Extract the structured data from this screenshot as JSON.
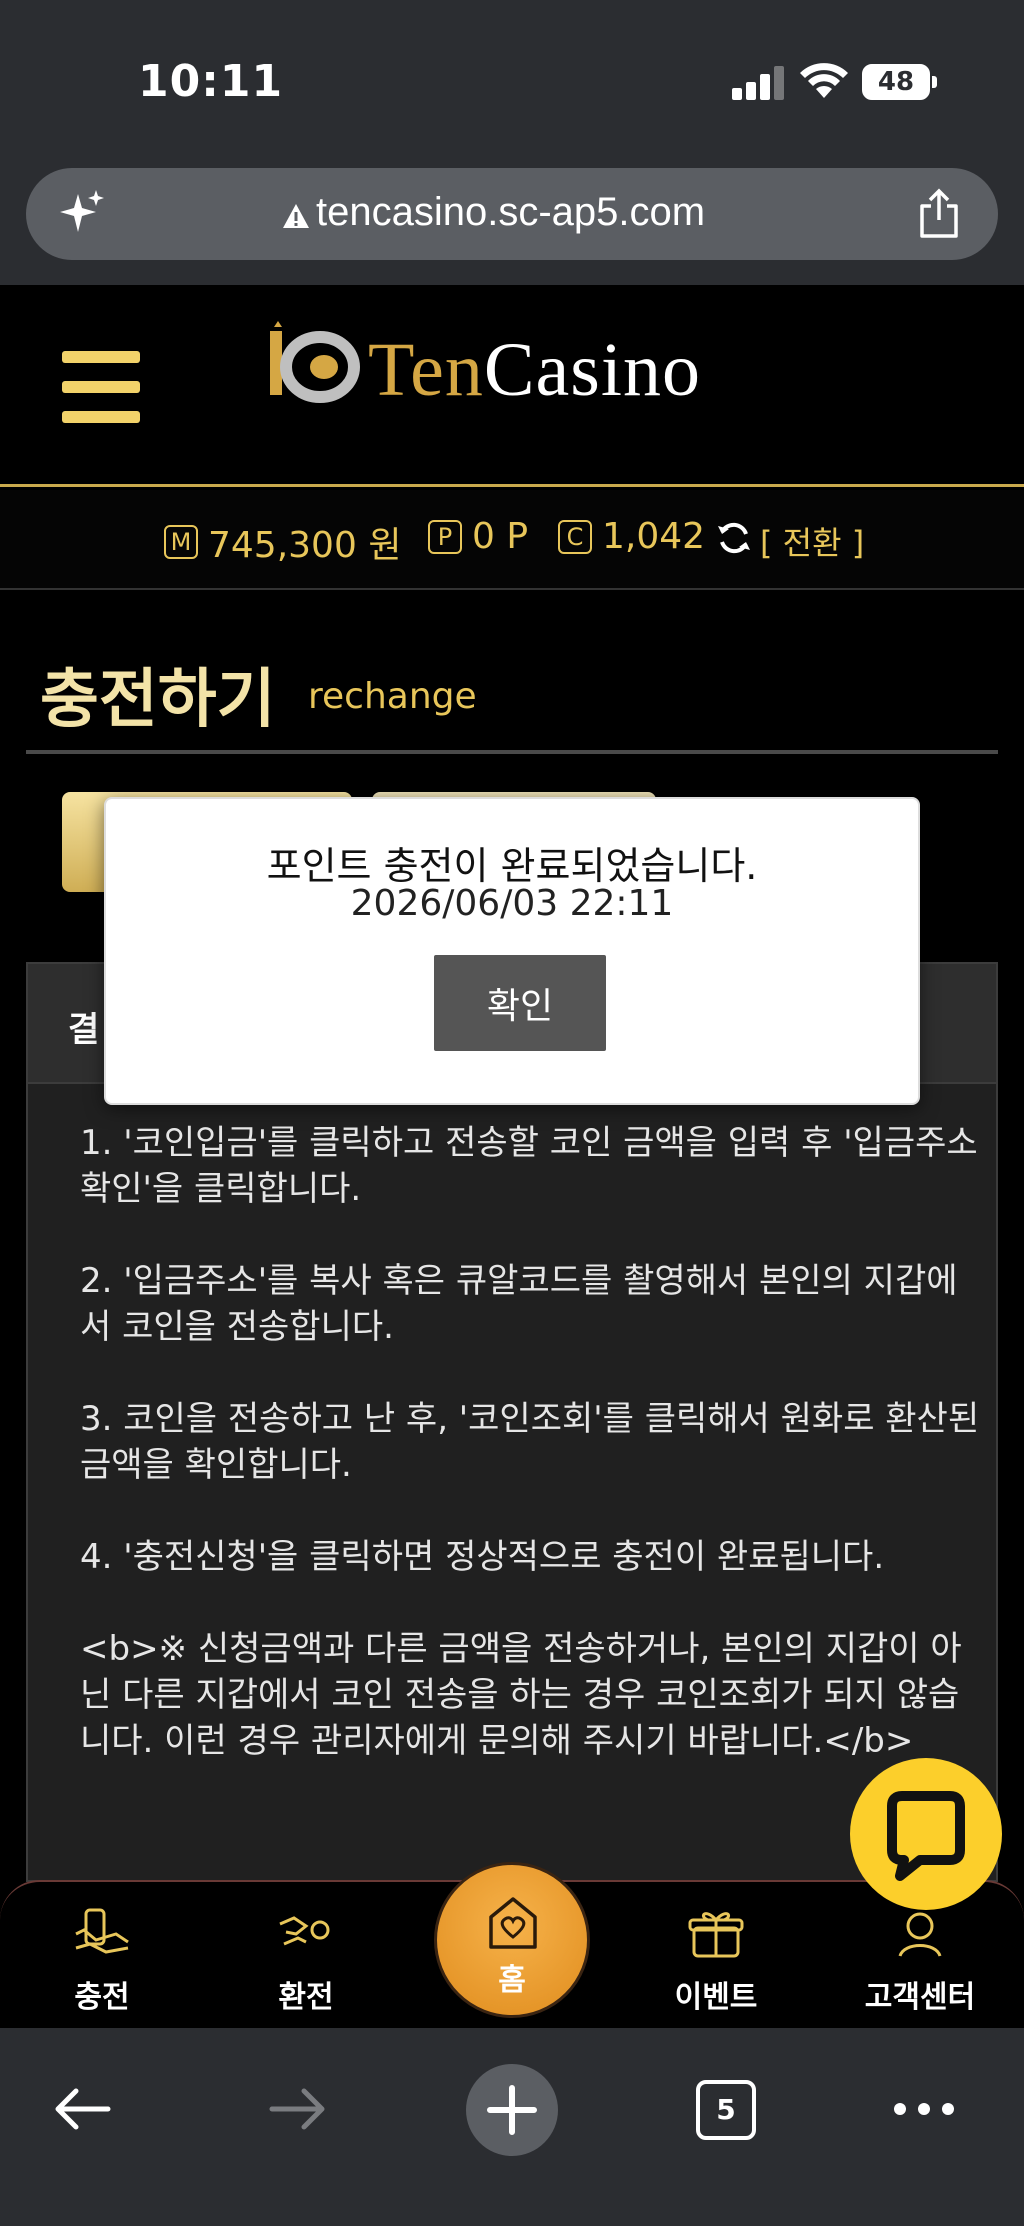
{
  "status_bar": {
    "time": "10:11",
    "battery": "48"
  },
  "browser": {
    "url": "tencasino.sc-ap5.com",
    "tab_count": "5"
  },
  "header": {
    "logo_ten": "Ten",
    "logo_casino": "Casino"
  },
  "balance": {
    "money_icon": "M",
    "money": "745,300 원",
    "point_icon": "P",
    "points": "0 P",
    "coin_icon": "C",
    "coins": "1,042",
    "convert_label": "[ 전환 ]"
  },
  "page": {
    "title": "충전하기",
    "subtitle": "rechange"
  },
  "card": {
    "head_label": "결",
    "instructions": "1. '코인입금'를 클릭하고 전송할 코인 금액을 입력 후 '입금주소확인'을 클릭합니다.\n\n2. '입금주소'를 복사 혹은 큐알코드를 촬영해서 본인의 지갑에서 코인을 전송합니다.\n\n3. 코인을 전송하고 난 후, '코인조회'를 클릭해서 원화로 환산된 금액을 확인합니다.\n\n4. '충전신청'을 클릭하면 정상적으로 충전이 완료됩니다.\n\n<b>※ 신청금액과 다른 금액을 전송하거나, 본인의 지갑이 아닌 다른 지갑에서 코인 전송을 하는 경우 코인조회가 되지 않습니다. 이런 경우 관리자에게 문의해 주시기 바랍니다.</b>"
  },
  "modal": {
    "message": "포인트 충전이 완료되었습니다.",
    "date": "2026/06/03 22:11",
    "confirm_label": "확인"
  },
  "bottom_nav": {
    "charge": "충전",
    "exchange": "환전",
    "home": "홈",
    "event": "이벤트",
    "support": "고객센터"
  },
  "colors": {
    "accent_gold": "#e8c65a",
    "chat_yellow": "#fccf2b",
    "home_orange": "#f0a33a"
  }
}
